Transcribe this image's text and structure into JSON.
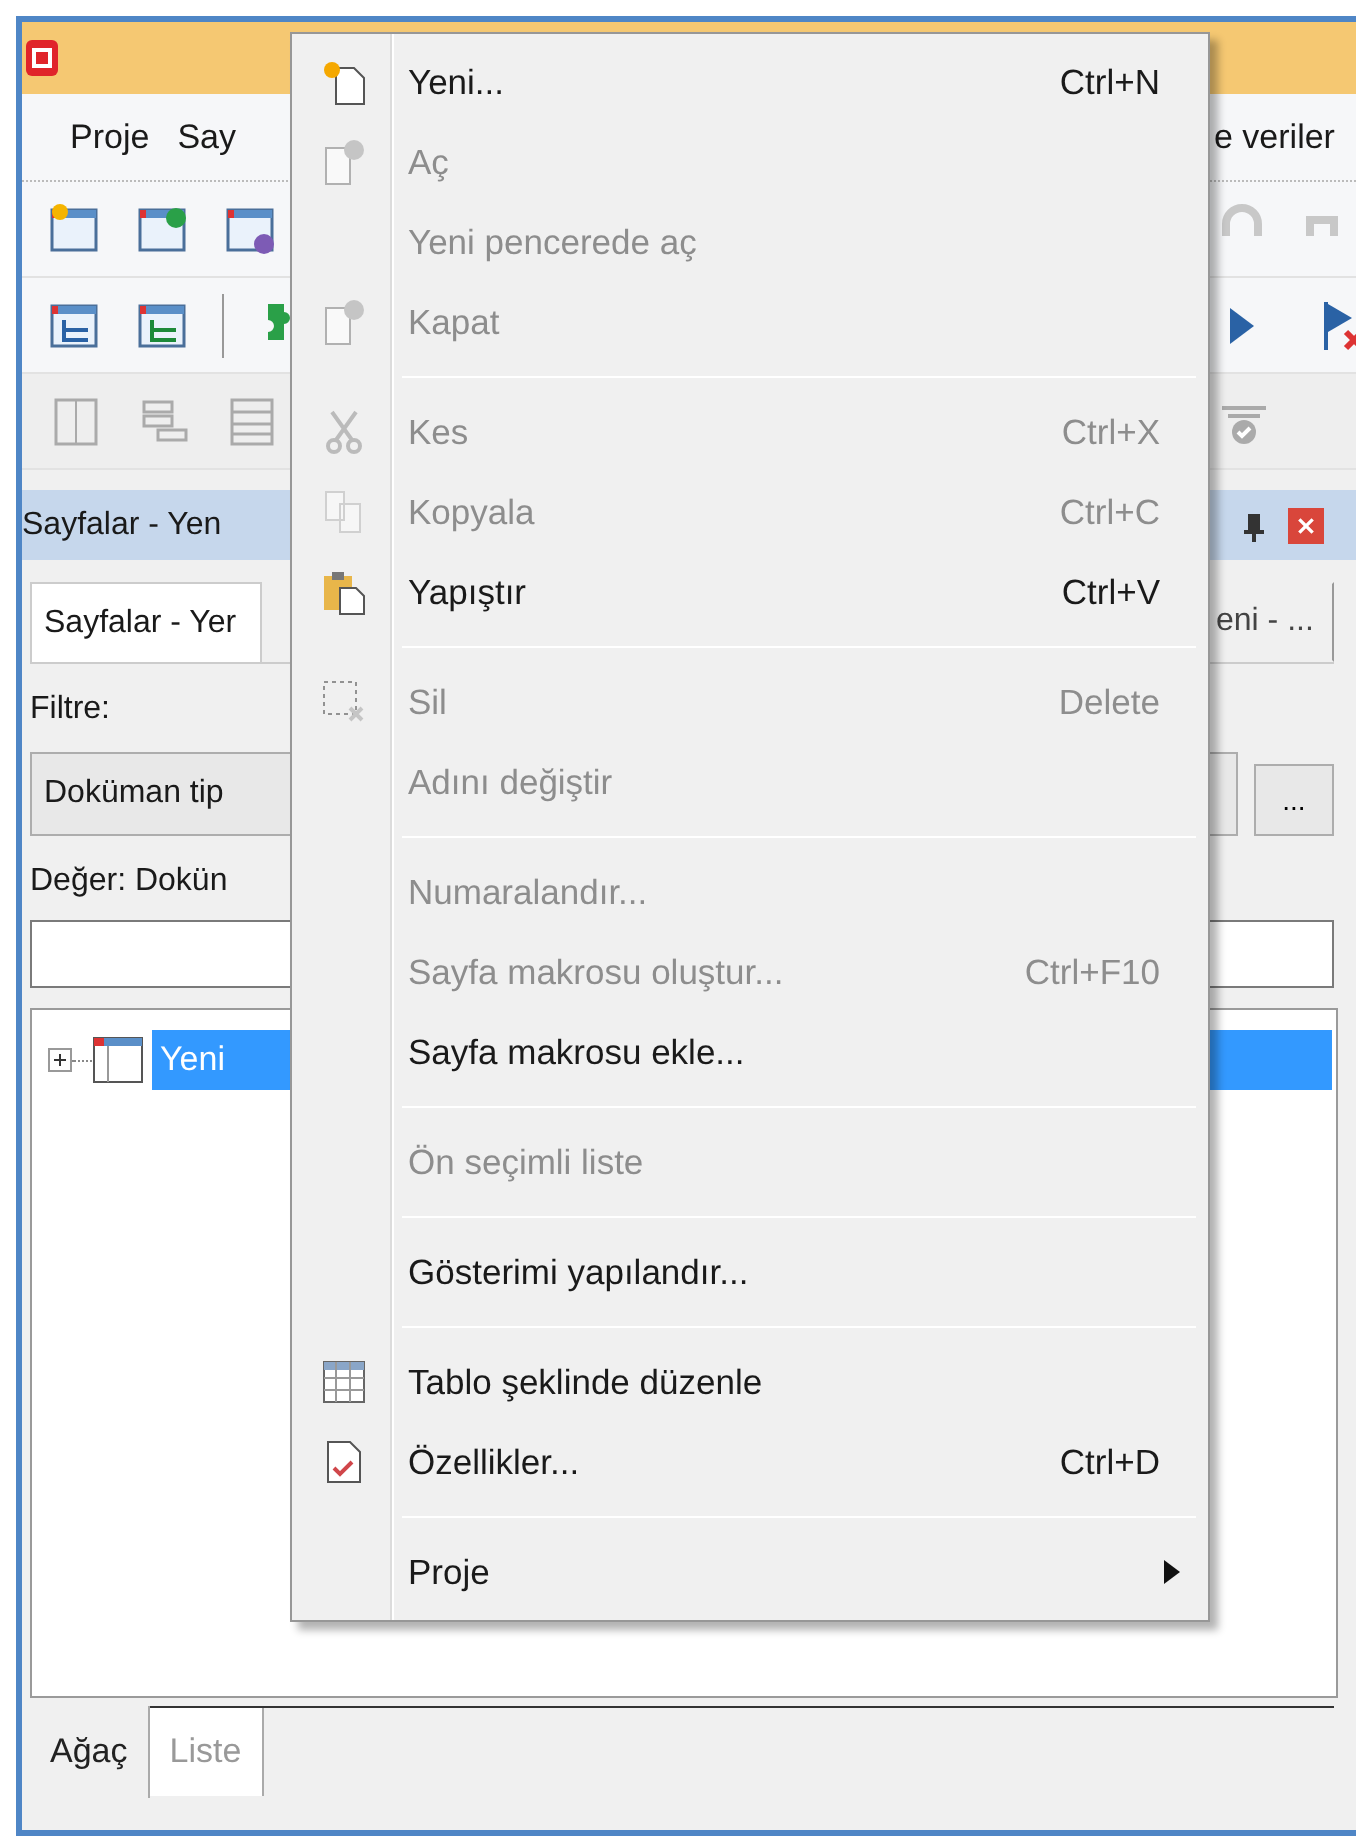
{
  "menu_bar": {
    "items": [
      "Proje",
      "Say"
    ],
    "trailing": "e veriler"
  },
  "panel": {
    "title": "Sayfalar - Yen",
    "tabs": [
      {
        "label": "Sayfalar - Yer",
        "selected": true
      },
      {
        "label": "eni - ...",
        "selected": false
      }
    ],
    "filter_label": "Filtre:",
    "filter_value": "Doküman tip",
    "browse_button": "...",
    "value_label": "Değer: Dokün",
    "tree": [
      {
        "label": "Yeni",
        "selected": true,
        "expanded": false
      }
    ],
    "bottom_tabs": [
      {
        "label": "Ağaç",
        "selected": true
      },
      {
        "label": "Liste",
        "selected": false
      }
    ]
  },
  "context_menu": {
    "items": [
      {
        "kind": "item",
        "label": "Yeni...",
        "shortcut": "Ctrl+N",
        "disabled": false
      },
      {
        "kind": "item",
        "label": "Aç",
        "disabled": true
      },
      {
        "kind": "item",
        "label": "Yeni pencerede aç",
        "disabled": true
      },
      {
        "kind": "item",
        "label": "Kapat",
        "disabled": true
      },
      {
        "kind": "separator"
      },
      {
        "kind": "item",
        "label": "Kes",
        "shortcut": "Ctrl+X",
        "disabled": true
      },
      {
        "kind": "item",
        "label": "Kopyala",
        "shortcut": "Ctrl+C",
        "disabled": true
      },
      {
        "kind": "item",
        "label": "Yapıştır",
        "shortcut": "Ctrl+V",
        "disabled": false
      },
      {
        "kind": "separator"
      },
      {
        "kind": "item",
        "label": "Sil",
        "shortcut": "Delete",
        "disabled": true
      },
      {
        "kind": "item",
        "label": "Adını değiştir",
        "disabled": true
      },
      {
        "kind": "separator"
      },
      {
        "kind": "item",
        "label": "Numaralandır...",
        "disabled": true
      },
      {
        "kind": "item",
        "label": "Sayfa makrosu oluştur...",
        "shortcut": "Ctrl+F10",
        "disabled": true
      },
      {
        "kind": "item",
        "label": "Sayfa makrosu ekle...",
        "disabled": false
      },
      {
        "kind": "separator"
      },
      {
        "kind": "item",
        "label": "Ön seçimli liste",
        "disabled": true
      },
      {
        "kind": "separator"
      },
      {
        "kind": "item",
        "label": "Gösterimi yapılandır...",
        "disabled": false
      },
      {
        "kind": "separator"
      },
      {
        "kind": "item",
        "label": "Tablo şeklinde düzenle",
        "disabled": false
      },
      {
        "kind": "item",
        "label": "Özellikler...",
        "shortcut": "Ctrl+D",
        "disabled": false
      },
      {
        "kind": "separator"
      },
      {
        "kind": "item",
        "label": "Proje",
        "disabled": false,
        "submenu": true
      }
    ]
  }
}
